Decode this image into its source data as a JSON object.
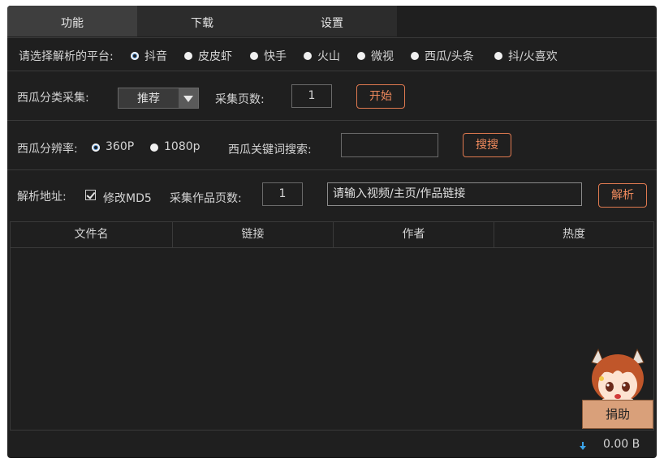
{
  "tabs": [
    {
      "label": "功能"
    },
    {
      "label": "下载"
    },
    {
      "label": "设置"
    }
  ],
  "platform": {
    "label": "请选择解析的平台:",
    "options": [
      "抖音",
      "皮皮虾",
      "快手",
      "火山",
      "微视",
      "西瓜/头条",
      "抖/火喜欢"
    ],
    "selected": "抖音"
  },
  "xigua_category": {
    "label": "西瓜分类采集:",
    "select_value": "推荐",
    "pages_label": "采集页数:",
    "pages_value": "1",
    "start_button": "开始"
  },
  "xigua_resolution": {
    "label": "西瓜分辨率:",
    "options": [
      "360P",
      "1080p"
    ],
    "selected": "360P",
    "keyword_label": "西瓜关键词搜索:",
    "keyword_value": "",
    "search_button": "搜搜"
  },
  "parse": {
    "label": "解析地址:",
    "md5_label": "修改MD5",
    "md5_checked": true,
    "pages_label": "采集作品页数:",
    "pages_value": "1",
    "url_placeholder": "请输入视频/主页/作品链接",
    "parse_button": "解析"
  },
  "table": {
    "columns": [
      "文件名",
      "链接",
      "作者",
      "热度"
    ],
    "rows": []
  },
  "status": {
    "speed": "0.00 B"
  },
  "donate": {
    "label": "捐助"
  },
  "colors": {
    "background": "#1f1f1f",
    "accent_button": "#f08a5d",
    "radio_selected": "#4a90d9"
  }
}
